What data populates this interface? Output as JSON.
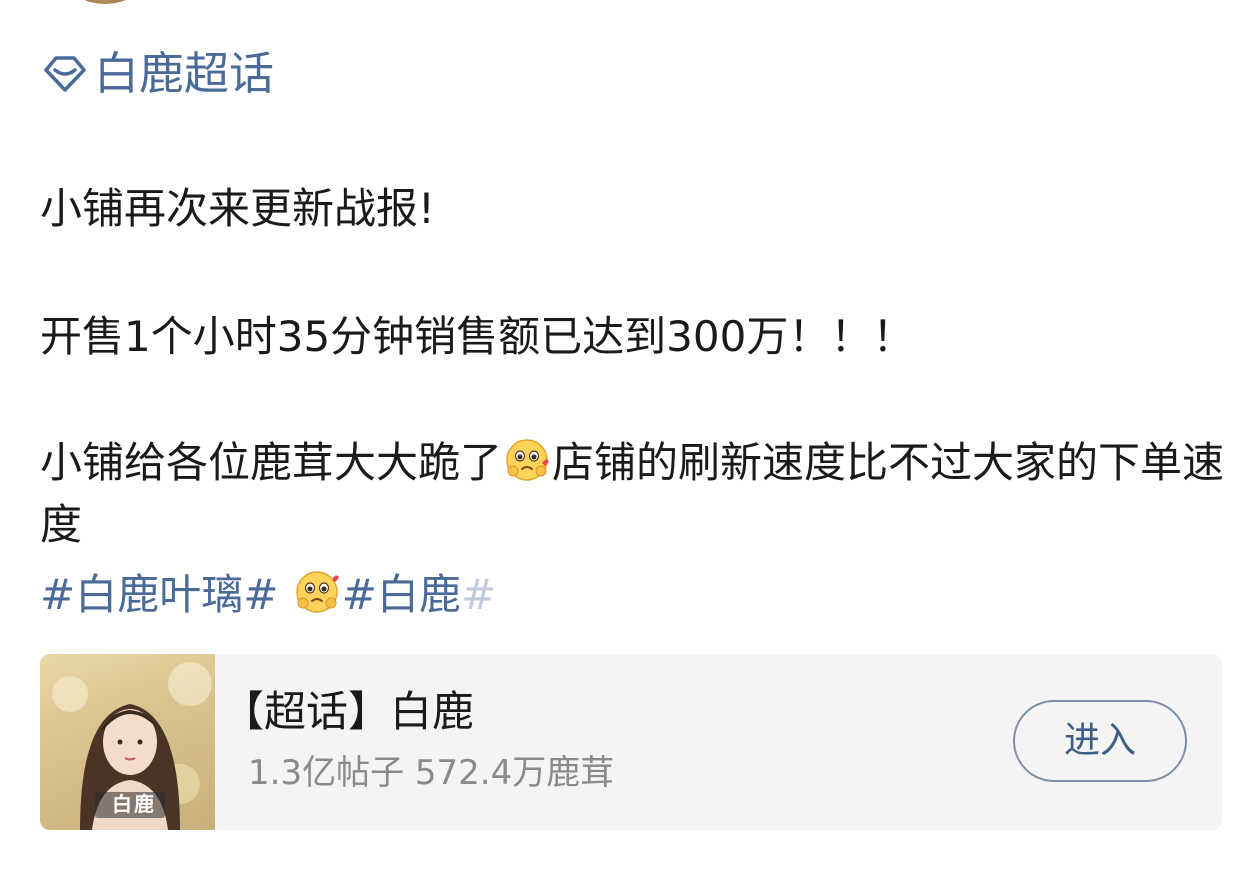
{
  "topic": {
    "label": "白鹿超话",
    "icon": "super-topic-diamond-icon",
    "color": "#4a6a97"
  },
  "post": {
    "line1": "小铺再次来更新战报!",
    "line2": "开售1个小时35分钟销售额已达到300万！！！",
    "line3_part1": "小铺给各位鹿茸大大跪了",
    "line3_part2": "店铺的刷新速度比不过大家的下单速度",
    "emoji": "pleading-face-emoji"
  },
  "hashtags": {
    "tag1": "#白鹿叶璃#",
    "tag2_main": "#白鹿",
    "tag2_end": "#"
  },
  "card": {
    "title": "【超话】白鹿",
    "subtitle": "1.3亿帖子 572.4万鹿茸",
    "thumb_text": "白鹿",
    "button_label": "进入"
  }
}
